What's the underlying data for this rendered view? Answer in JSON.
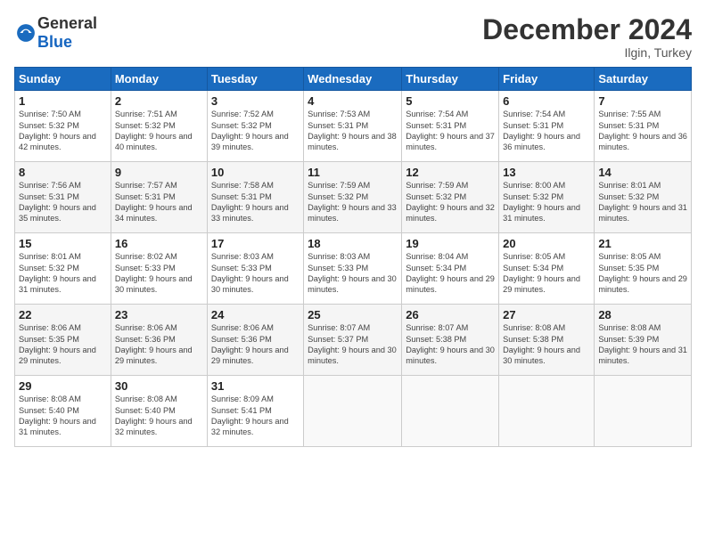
{
  "header": {
    "logo_general": "General",
    "logo_blue": "Blue",
    "title": "December 2024",
    "location": "Ilgin, Turkey"
  },
  "weekdays": [
    "Sunday",
    "Monday",
    "Tuesday",
    "Wednesday",
    "Thursday",
    "Friday",
    "Saturday"
  ],
  "weeks": [
    [
      {
        "day": "1",
        "sunrise": "Sunrise: 7:50 AM",
        "sunset": "Sunset: 5:32 PM",
        "daylight": "Daylight: 9 hours and 42 minutes."
      },
      {
        "day": "2",
        "sunrise": "Sunrise: 7:51 AM",
        "sunset": "Sunset: 5:32 PM",
        "daylight": "Daylight: 9 hours and 40 minutes."
      },
      {
        "day": "3",
        "sunrise": "Sunrise: 7:52 AM",
        "sunset": "Sunset: 5:32 PM",
        "daylight": "Daylight: 9 hours and 39 minutes."
      },
      {
        "day": "4",
        "sunrise": "Sunrise: 7:53 AM",
        "sunset": "Sunset: 5:31 PM",
        "daylight": "Daylight: 9 hours and 38 minutes."
      },
      {
        "day": "5",
        "sunrise": "Sunrise: 7:54 AM",
        "sunset": "Sunset: 5:31 PM",
        "daylight": "Daylight: 9 hours and 37 minutes."
      },
      {
        "day": "6",
        "sunrise": "Sunrise: 7:54 AM",
        "sunset": "Sunset: 5:31 PM",
        "daylight": "Daylight: 9 hours and 36 minutes."
      },
      {
        "day": "7",
        "sunrise": "Sunrise: 7:55 AM",
        "sunset": "Sunset: 5:31 PM",
        "daylight": "Daylight: 9 hours and 36 minutes."
      }
    ],
    [
      {
        "day": "8",
        "sunrise": "Sunrise: 7:56 AM",
        "sunset": "Sunset: 5:31 PM",
        "daylight": "Daylight: 9 hours and 35 minutes."
      },
      {
        "day": "9",
        "sunrise": "Sunrise: 7:57 AM",
        "sunset": "Sunset: 5:31 PM",
        "daylight": "Daylight: 9 hours and 34 minutes."
      },
      {
        "day": "10",
        "sunrise": "Sunrise: 7:58 AM",
        "sunset": "Sunset: 5:31 PM",
        "daylight": "Daylight: 9 hours and 33 minutes."
      },
      {
        "day": "11",
        "sunrise": "Sunrise: 7:59 AM",
        "sunset": "Sunset: 5:32 PM",
        "daylight": "Daylight: 9 hours and 33 minutes."
      },
      {
        "day": "12",
        "sunrise": "Sunrise: 7:59 AM",
        "sunset": "Sunset: 5:32 PM",
        "daylight": "Daylight: 9 hours and 32 minutes."
      },
      {
        "day": "13",
        "sunrise": "Sunrise: 8:00 AM",
        "sunset": "Sunset: 5:32 PM",
        "daylight": "Daylight: 9 hours and 31 minutes."
      },
      {
        "day": "14",
        "sunrise": "Sunrise: 8:01 AM",
        "sunset": "Sunset: 5:32 PM",
        "daylight": "Daylight: 9 hours and 31 minutes."
      }
    ],
    [
      {
        "day": "15",
        "sunrise": "Sunrise: 8:01 AM",
        "sunset": "Sunset: 5:32 PM",
        "daylight": "Daylight: 9 hours and 31 minutes."
      },
      {
        "day": "16",
        "sunrise": "Sunrise: 8:02 AM",
        "sunset": "Sunset: 5:33 PM",
        "daylight": "Daylight: 9 hours and 30 minutes."
      },
      {
        "day": "17",
        "sunrise": "Sunrise: 8:03 AM",
        "sunset": "Sunset: 5:33 PM",
        "daylight": "Daylight: 9 hours and 30 minutes."
      },
      {
        "day": "18",
        "sunrise": "Sunrise: 8:03 AM",
        "sunset": "Sunset: 5:33 PM",
        "daylight": "Daylight: 9 hours and 30 minutes."
      },
      {
        "day": "19",
        "sunrise": "Sunrise: 8:04 AM",
        "sunset": "Sunset: 5:34 PM",
        "daylight": "Daylight: 9 hours and 29 minutes."
      },
      {
        "day": "20",
        "sunrise": "Sunrise: 8:05 AM",
        "sunset": "Sunset: 5:34 PM",
        "daylight": "Daylight: 9 hours and 29 minutes."
      },
      {
        "day": "21",
        "sunrise": "Sunrise: 8:05 AM",
        "sunset": "Sunset: 5:35 PM",
        "daylight": "Daylight: 9 hours and 29 minutes."
      }
    ],
    [
      {
        "day": "22",
        "sunrise": "Sunrise: 8:06 AM",
        "sunset": "Sunset: 5:35 PM",
        "daylight": "Daylight: 9 hours and 29 minutes."
      },
      {
        "day": "23",
        "sunrise": "Sunrise: 8:06 AM",
        "sunset": "Sunset: 5:36 PM",
        "daylight": "Daylight: 9 hours and 29 minutes."
      },
      {
        "day": "24",
        "sunrise": "Sunrise: 8:06 AM",
        "sunset": "Sunset: 5:36 PM",
        "daylight": "Daylight: 9 hours and 29 minutes."
      },
      {
        "day": "25",
        "sunrise": "Sunrise: 8:07 AM",
        "sunset": "Sunset: 5:37 PM",
        "daylight": "Daylight: 9 hours and 30 minutes."
      },
      {
        "day": "26",
        "sunrise": "Sunrise: 8:07 AM",
        "sunset": "Sunset: 5:38 PM",
        "daylight": "Daylight: 9 hours and 30 minutes."
      },
      {
        "day": "27",
        "sunrise": "Sunrise: 8:08 AM",
        "sunset": "Sunset: 5:38 PM",
        "daylight": "Daylight: 9 hours and 30 minutes."
      },
      {
        "day": "28",
        "sunrise": "Sunrise: 8:08 AM",
        "sunset": "Sunset: 5:39 PM",
        "daylight": "Daylight: 9 hours and 31 minutes."
      }
    ],
    [
      {
        "day": "29",
        "sunrise": "Sunrise: 8:08 AM",
        "sunset": "Sunset: 5:40 PM",
        "daylight": "Daylight: 9 hours and 31 minutes."
      },
      {
        "day": "30",
        "sunrise": "Sunrise: 8:08 AM",
        "sunset": "Sunset: 5:40 PM",
        "daylight": "Daylight: 9 hours and 32 minutes."
      },
      {
        "day": "31",
        "sunrise": "Sunrise: 8:09 AM",
        "sunset": "Sunset: 5:41 PM",
        "daylight": "Daylight: 9 hours and 32 minutes."
      },
      null,
      null,
      null,
      null
    ]
  ]
}
